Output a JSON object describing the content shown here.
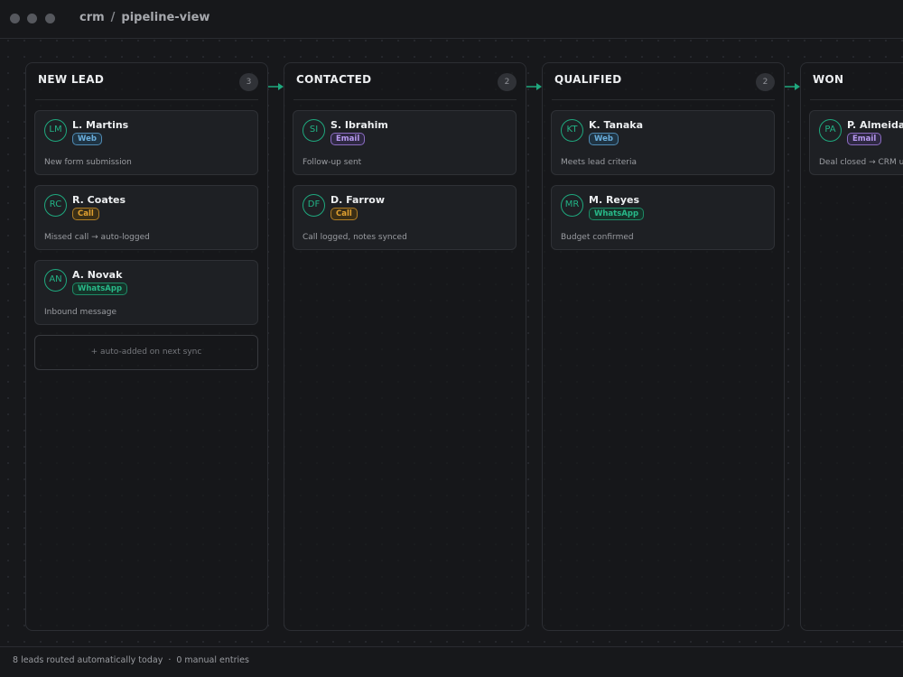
{
  "breadcrumb": {
    "root": "crm",
    "separator": "/",
    "current": "pipeline-view"
  },
  "columns": [
    {
      "title": "NEW LEAD",
      "count": "3"
    },
    {
      "title": "CONTACTED",
      "count": "2"
    },
    {
      "title": "QUALIFIED",
      "count": "2"
    },
    {
      "title": "WON"
    }
  ],
  "cards": {
    "new_lead": [
      {
        "initials": "LM",
        "name": "L. Martins",
        "source": "Web",
        "note": "New form submission"
      },
      {
        "initials": "RC",
        "name": "R. Coates",
        "source": "Call",
        "note": "Missed call → auto-logged"
      },
      {
        "initials": "AN",
        "name": "A. Novak",
        "source": "WhatsApp",
        "note": "Inbound message"
      }
    ],
    "contacted": [
      {
        "initials": "SI",
        "name": "S. Ibrahim",
        "source": "Email",
        "note": "Follow-up sent"
      },
      {
        "initials": "DF",
        "name": "D. Farrow",
        "source": "Call",
        "note": "Call logged, notes synced"
      }
    ],
    "qualified": [
      {
        "initials": "KT",
        "name": "K. Tanaka",
        "source": "Web",
        "note": "Meets lead criteria"
      },
      {
        "initials": "MR",
        "name": "M. Reyes",
        "source": "WhatsApp",
        "note": "Budget confirmed"
      }
    ],
    "won": [
      {
        "initials": "PA",
        "name": "P. Almeida",
        "source": "Email",
        "note": "Deal closed → CRM u"
      }
    ]
  },
  "placeholder": "+ auto-added on next sync",
  "footer": {
    "leads_text": "8 leads routed automatically today",
    "separator": "·",
    "manual_text": "0 manual entries"
  },
  "colors": {
    "accent": "#1fa87e",
    "web": "#6aaedc",
    "email": "#b89af0",
    "call": "#e0a030",
    "whatsapp": "#28b888"
  }
}
